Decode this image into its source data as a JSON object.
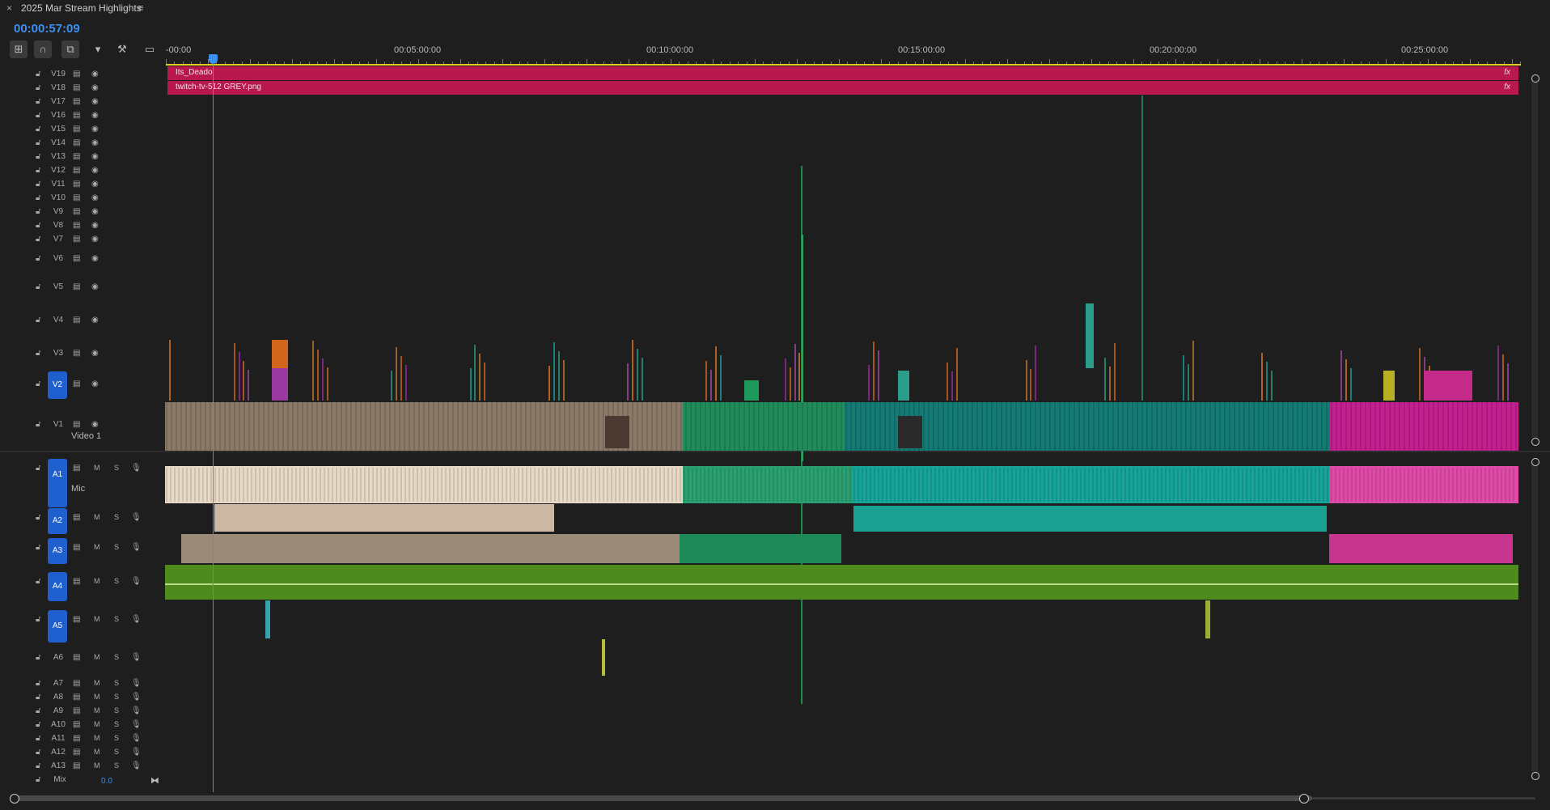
{
  "sequence": {
    "title": "2025 Mar Stream Highlights",
    "timecode": "00:00:57:09"
  },
  "ruler": {
    "labels": [
      "-00:00",
      "00:05:00:00",
      "00:10:00:00",
      "00:15:00:00",
      "00:20:00:00",
      "00:25:00:00"
    ]
  },
  "toolbar": {
    "tools": [
      "insert-nest-icon",
      "snap-magnet-icon",
      "linked-selection-icon",
      "add-marker-icon",
      "settings-wrench-icon",
      "captions-icon"
    ]
  },
  "video_tracks": [
    "V19",
    "V18",
    "V17",
    "V16",
    "V15",
    "V14",
    "V13",
    "V12",
    "V11",
    "V10",
    "V9",
    "V8",
    "V7",
    "V6",
    "V5",
    "V4",
    "V3",
    "V2",
    "V1"
  ],
  "video_track_label": "Video 1",
  "audio_tracks": [
    "A1",
    "A2",
    "A3",
    "A4",
    "A5",
    "A6",
    "A7",
    "A8",
    "A9",
    "A10",
    "A11",
    "A12",
    "A13"
  ],
  "audio_track_label": "Mic",
  "audio_buttons": {
    "mute": "M",
    "solo": "S"
  },
  "mix": {
    "label": "Mix",
    "value": "0.0"
  },
  "clips": {
    "v19_label": "Its_Deado",
    "v18_label": "twitch-tv-512 GREY.png",
    "fx": "fx"
  },
  "colors": {
    "accent": "#3d8ff0",
    "overlay": "#b8184e",
    "tan": "#8c7a68",
    "green": "#1f8c5a",
    "teal": "#17a59a",
    "pink": "#c21f8f",
    "cream": "#e8d8c6",
    "audio_green": "#4e8a1e"
  }
}
